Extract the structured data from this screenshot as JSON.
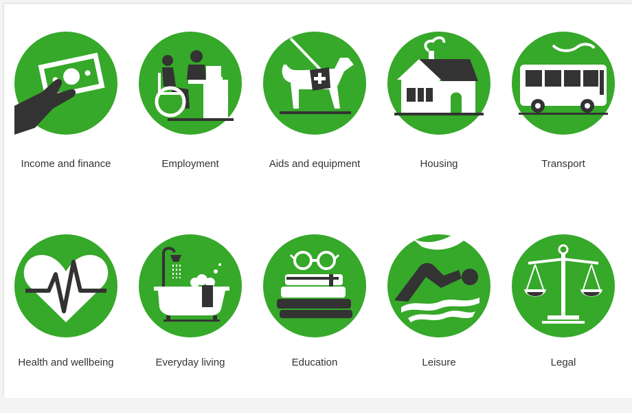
{
  "colors": {
    "accent": "#36a82a",
    "dark": "#333333",
    "background": "#ffffff"
  },
  "categories": [
    {
      "label": "Income and finance",
      "icon": "hand-holding-money-icon"
    },
    {
      "label": "Employment",
      "icon": "office-workers-icon"
    },
    {
      "label": "Aids and equipment",
      "icon": "guide-dog-icon"
    },
    {
      "label": "Housing",
      "icon": "house-icon"
    },
    {
      "label": "Transport",
      "icon": "bus-icon"
    },
    {
      "label": "Health and wellbeing",
      "icon": "heartbeat-icon"
    },
    {
      "label": "Everyday living",
      "icon": "bathtub-icon"
    },
    {
      "label": "Education",
      "icon": "books-and-glasses-icon"
    },
    {
      "label": "Leisure",
      "icon": "swimmer-icon"
    },
    {
      "label": "Legal",
      "icon": "scales-of-justice-icon"
    }
  ]
}
